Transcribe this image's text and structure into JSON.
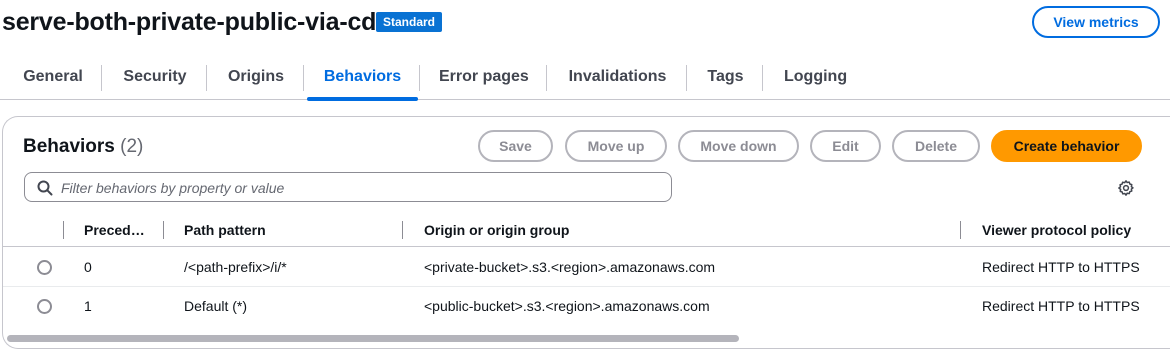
{
  "header": {
    "title": "serve-both-private-public-via-cdn",
    "badge": "Standard",
    "view_metrics_label": "View metrics"
  },
  "tabs": [
    {
      "label": "General"
    },
    {
      "label": "Security"
    },
    {
      "label": "Origins"
    },
    {
      "label": "Behaviors",
      "active": true
    },
    {
      "label": "Error pages"
    },
    {
      "label": "Invalidations"
    },
    {
      "label": "Tags"
    },
    {
      "label": "Logging"
    }
  ],
  "behaviors": {
    "title": "Behaviors",
    "count": "(2)",
    "buttons": {
      "save": "Save",
      "move_up": "Move up",
      "move_down": "Move down",
      "edit": "Edit",
      "delete": "Delete",
      "create": "Create behavior"
    },
    "filter_placeholder": "Filter behaviors by property or value",
    "columns": {
      "precedence": "Preced…",
      "path_pattern": "Path pattern",
      "origin": "Origin or origin group",
      "viewer_protocol": "Viewer protocol policy"
    },
    "rows": [
      {
        "precedence": "0",
        "path_pattern": "/<path-prefix>/i/*",
        "origin": "<private-bucket>.s3.<region>.amazonaws.com",
        "viewer_protocol": "Redirect HTTP to HTTPS"
      },
      {
        "precedence": "1",
        "path_pattern": "Default (*)",
        "origin": "<public-bucket>.s3.<region>.amazonaws.com",
        "viewer_protocol": "Redirect HTTP to HTTPS"
      }
    ]
  },
  "colors": {
    "accent": "#006ce0",
    "badge": "#0972d3",
    "primary_button": "#ff9900"
  }
}
